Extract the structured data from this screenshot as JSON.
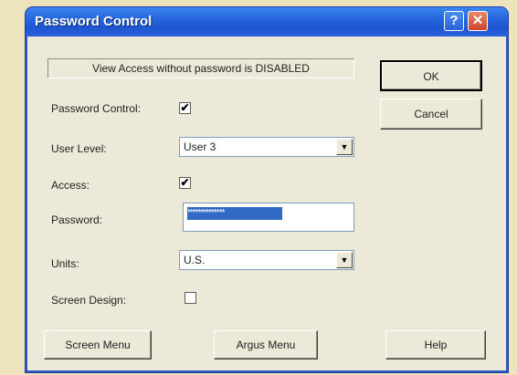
{
  "window": {
    "title": "Password Control"
  },
  "titlebar": {
    "help_glyph": "?",
    "close_glyph": "✕"
  },
  "info": {
    "text": "View Access without password is DISABLED"
  },
  "buttons": {
    "ok": "OK",
    "cancel": "Cancel",
    "screen_menu": "Screen Menu",
    "argus_menu": "Argus Menu",
    "help": "Help"
  },
  "form": {
    "password_control": {
      "label": "Password Control:",
      "checked": true,
      "mark": "✔"
    },
    "user_level": {
      "label": "User Level:",
      "value": "User 3"
    },
    "access": {
      "label": "Access:",
      "checked": true,
      "mark": "✔"
    },
    "password": {
      "label": "Password:",
      "value": "**************"
    },
    "units": {
      "label": "Units:",
      "value": "U.S."
    },
    "screen_design": {
      "label": "Screen Design:",
      "checked": false,
      "mark": ""
    }
  },
  "icons": {
    "dropdown": "▼"
  },
  "colors": {
    "titlebar": "#2565de",
    "dialog": "#ece9d8",
    "selection": "#316ac5",
    "background": "#ede3bd"
  }
}
